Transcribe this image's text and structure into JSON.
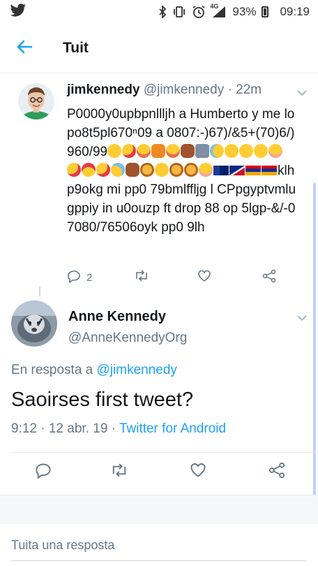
{
  "status_bar": {
    "battery": "93%",
    "time": "09:19",
    "network": "4G",
    "icons": [
      "twitter-bird-icon",
      "bluetooth-icon",
      "vibrate-icon",
      "alarm-icon",
      "signal-icon",
      "battery-icon"
    ]
  },
  "app_bar": {
    "title": "Tuit",
    "back_icon": "arrow-left-icon"
  },
  "parent_tweet": {
    "name": "jimkennedy",
    "handle": "@jimkennedy",
    "separator": " · ",
    "time": "22m",
    "text_part1": "P0000y0upbpnllljh a Humberto y me lo po8t5pl670ⁿ09 a 0807:-)67)/&5+(70)6/)960/99",
    "text_part2": "klhp9okg mi pp0 79bmlffljg l CPpgyptvmlugppiy in u0ouzp ft drop 88 op 5lgp-&/-07080/76506oyk pp0 9lh",
    "emojis_part1": [
      "kissing-emoji",
      "kiss-wink-emoji",
      "yum-emoji",
      "fox-emoji",
      "yum-emoji",
      "deer-emoji",
      "stadium-emoji",
      "disappointed-relieved-emoji",
      "confounded-emoji",
      "tired-face-emoji",
      "relieved-emoji",
      "blush-emoji",
      "kiss-wink-emoji",
      "heart-eyes-emoji",
      "kiss-wink-emoji",
      "sweat-smile-emoji",
      "deer-emoji",
      "lion-emoji"
    ],
    "emojis_part2": [
      "confounded-emoji",
      "lion-emoji",
      "lion-emoji",
      "blush-emoji",
      "australia-flag",
      "american-samoa-flag",
      "armenia-flag",
      "armenia-flag"
    ],
    "reply_count": "2"
  },
  "main_tweet": {
    "name": "Anne Kennedy",
    "handle": "@AnneKennedyOrg",
    "reply_prefix": "En resposta a ",
    "reply_to": "@jimkennedy",
    "text": "Saoirses first tweet?",
    "time": "9:12 · 12 abr. 19 · ",
    "source": "Twitter for Android"
  },
  "reply_box": {
    "placeholder": "Tuita una resposta"
  },
  "colors": {
    "accent": "#1da1f2",
    "secondary_text": "#657786",
    "divider": "#e6ecf0",
    "scrollbar": "#bcd3f0"
  }
}
